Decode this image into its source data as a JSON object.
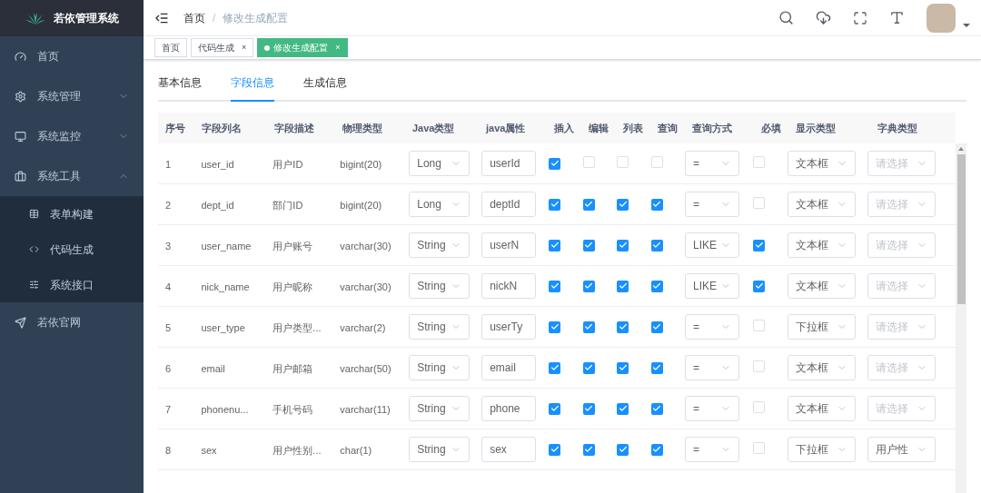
{
  "sidebar": {
    "title": "若依管理系统",
    "items": [
      {
        "label": "首页"
      },
      {
        "label": "系统管理",
        "expanded": false
      },
      {
        "label": "系统监控",
        "expanded": false
      },
      {
        "label": "系统工具",
        "expanded": true,
        "children": [
          {
            "label": "表单构建"
          },
          {
            "label": "代码生成"
          },
          {
            "label": "系统接口"
          }
        ]
      },
      {
        "label": "若依官网"
      }
    ]
  },
  "breadcrumb": {
    "items": [
      "首页",
      "修改生成配置"
    ],
    "separator": "/"
  },
  "tags": [
    {
      "label": "首页",
      "selected": false
    },
    {
      "label": "代码生成",
      "close": "×",
      "selected": false
    },
    {
      "label": "修改生成配置",
      "close": "×",
      "selected": true
    }
  ],
  "tabs": [
    {
      "label": "基本信息",
      "selected": false
    },
    {
      "label": "字段信息",
      "selected": true
    },
    {
      "label": "生成信息",
      "selected": false
    }
  ],
  "table": {
    "columns": [
      "序号",
      "字段列名",
      "字段描述",
      "物理类型",
      "Java类型",
      "java属性",
      "插入",
      "编辑",
      "列表",
      "查询",
      "查询方式",
      "必填",
      "显示类型",
      "字典类型"
    ],
    "rows": [
      {
        "index": "1",
        "column": "user_id",
        "desc": "用户ID",
        "type": "bigint(20)",
        "java_type": "Long",
        "java_field": "userId",
        "insert": true,
        "edit": false,
        "list": false,
        "query": false,
        "query_type": "=",
        "required": false,
        "html_type": "文本框",
        "dict": "请选择",
        "dict_placeholder": true
      },
      {
        "index": "2",
        "column": "dept_id",
        "desc": "部门ID",
        "type": "bigint(20)",
        "java_type": "Long",
        "java_field": "deptId",
        "insert": true,
        "edit": true,
        "list": true,
        "query": true,
        "query_type": "=",
        "required": false,
        "html_type": "文本框",
        "dict": "请选择",
        "dict_placeholder": true
      },
      {
        "index": "3",
        "column": "user_name",
        "desc": "用户账号",
        "type": "varchar(30)",
        "java_type": "String",
        "java_field": "userN",
        "insert": true,
        "edit": true,
        "list": true,
        "query": true,
        "query_type": "LIKE",
        "required": true,
        "html_type": "文本框",
        "dict": "请选择",
        "dict_placeholder": true
      },
      {
        "index": "4",
        "column": "nick_name",
        "desc": "用户昵称",
        "type": "varchar(30)",
        "java_type": "String",
        "java_field": "nickN",
        "insert": true,
        "edit": true,
        "list": true,
        "query": true,
        "query_type": "LIKE",
        "required": true,
        "html_type": "文本框",
        "dict": "请选择",
        "dict_placeholder": true
      },
      {
        "index": "5",
        "column": "user_type",
        "desc": "用户类型...",
        "type": "varchar(2)",
        "java_type": "String",
        "java_field": "userTy",
        "insert": true,
        "edit": true,
        "list": true,
        "query": true,
        "query_type": "=",
        "required": false,
        "html_type": "下拉框",
        "dict": "请选择",
        "dict_placeholder": true
      },
      {
        "index": "6",
        "column": "email",
        "desc": "用户邮箱",
        "type": "varchar(50)",
        "java_type": "String",
        "java_field": "email",
        "insert": true,
        "edit": true,
        "list": true,
        "query": true,
        "query_type": "=",
        "required": false,
        "html_type": "文本框",
        "dict": "请选择",
        "dict_placeholder": true
      },
      {
        "index": "7",
        "column": "phonenu...",
        "desc": "手机号码",
        "type": "varchar(11)",
        "java_type": "String",
        "java_field": "phone",
        "insert": true,
        "edit": true,
        "list": true,
        "query": true,
        "query_type": "=",
        "required": false,
        "html_type": "文本框",
        "dict": "请选择",
        "dict_placeholder": true
      },
      {
        "index": "8",
        "column": "sex",
        "desc": "用户性别...",
        "type": "char(1)",
        "java_type": "String",
        "java_field": "sex",
        "insert": true,
        "edit": true,
        "list": true,
        "query": true,
        "query_type": "=",
        "required": false,
        "html_type": "下拉框",
        "dict": "用户性",
        "dict_placeholder": false
      }
    ]
  }
}
